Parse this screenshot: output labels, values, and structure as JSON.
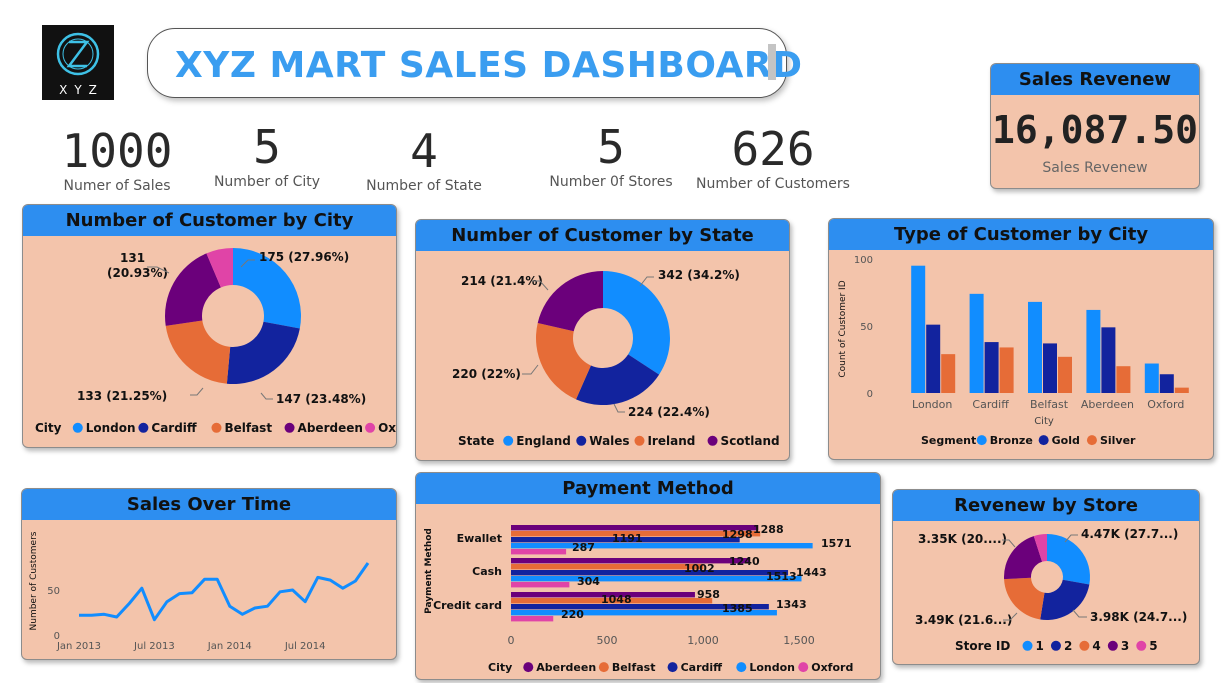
{
  "logo": {
    "text": "XYZ"
  },
  "title": "XYZ MART SALES DASHBOARD",
  "kpis": [
    {
      "value": "1000",
      "label": "Numer of Sales"
    },
    {
      "value": "5",
      "label": "Number of City"
    },
    {
      "value": "4",
      "label": "Number of State"
    },
    {
      "value": "5",
      "label": "Number 0f Stores"
    },
    {
      "value": "626",
      "label": "Number of Customers"
    }
  ],
  "revenue_card": {
    "title": "Sales Revenew",
    "value": "16,087.50",
    "label": "Sales Revenew"
  },
  "colors": {
    "bronze_blue": "#118dff",
    "navy": "#12239e",
    "orange": "#e66c37",
    "purple": "#6b007b",
    "pink": "#e044a7",
    "header": "#2d8ef0",
    "card_bg": "#f3c4ab"
  },
  "chart_data": [
    {
      "type": "pie",
      "title": "Number of Customer by City",
      "legend_title": "City",
      "categories": [
        "London",
        "Cardiff",
        "Belfast",
        "Aberdeen",
        "Oxford"
      ],
      "values": [
        175,
        147,
        133,
        131,
        40
      ],
      "data_labels": [
        "175 (27.96%)",
        "147 (23.48%)",
        "133 (21.25%)",
        "131",
        "(20.93%)"
      ],
      "colors": [
        "#118dff",
        "#12239e",
        "#e66c37",
        "#6b007b",
        "#e044a7"
      ],
      "legend_position": "bottom"
    },
    {
      "type": "pie",
      "title": "Number of Customer by State",
      "legend_title": "State",
      "categories": [
        "England",
        "Wales",
        "Ireland",
        "Scotland"
      ],
      "values": [
        342,
        224,
        220,
        214
      ],
      "data_labels": [
        "342 (34.2%)",
        "224 (22.4%)",
        "220 (22%)",
        "214 (21.4%)"
      ],
      "colors": [
        "#118dff",
        "#12239e",
        "#e66c37",
        "#6b007b"
      ],
      "legend_position": "bottom"
    },
    {
      "type": "bar",
      "title": "Type of Customer by City",
      "xlabel": "City",
      "ylabel": "Count of Customer ID",
      "legend_title": "Segment",
      "categories": [
        "London",
        "Cardiff",
        "Belfast",
        "Aberdeen",
        "Oxford"
      ],
      "series": [
        {
          "name": "Bronze",
          "values": [
            95,
            74,
            68,
            62,
            22
          ],
          "color": "#118dff"
        },
        {
          "name": "Gold",
          "values": [
            51,
            38,
            37,
            49,
            14
          ],
          "color": "#12239e"
        },
        {
          "name": "Silver",
          "values": [
            29,
            34,
            27,
            20,
            4
          ],
          "color": "#e66c37"
        }
      ],
      "ylim": [
        0,
        100
      ],
      "yticks": [
        "0",
        "50",
        "100"
      ],
      "legend_position": "bottom"
    },
    {
      "type": "line",
      "title": "Sales Over Time",
      "ylabel": "Number of Customers",
      "x": [
        "2013-01",
        "2013-02",
        "2013-03",
        "2013-04",
        "2013-05",
        "2013-06",
        "2013-07",
        "2013-08",
        "2013-09",
        "2013-10",
        "2013-11",
        "2013-12",
        "2014-01",
        "2014-02",
        "2014-03",
        "2014-04",
        "2014-05",
        "2014-06",
        "2014-07",
        "2014-08",
        "2014-09",
        "2014-10",
        "2014-11",
        "2014-12"
      ],
      "values": [
        22,
        22,
        23,
        20,
        35,
        52,
        17,
        37,
        46,
        47,
        62,
        62,
        32,
        23,
        30,
        32,
        48,
        50,
        37,
        64,
        61,
        52,
        60,
        80
      ],
      "xticks": [
        "Jan 2013",
        "Jul 2013",
        "Jan 2014",
        "Jul 2014"
      ],
      "yticks": [
        "0",
        "50"
      ],
      "color": "#118dff"
    },
    {
      "type": "bar",
      "orientation": "horizontal",
      "title": "Payment Method",
      "ylabel": "Payment Method",
      "legend_title": "City",
      "categories": [
        "Ewallet",
        "Cash",
        "Credit card"
      ],
      "series": [
        {
          "name": "Aberdeen",
          "values": [
            1288,
            1240,
            958
          ],
          "color": "#6b007b"
        },
        {
          "name": "Belfast",
          "values": [
            1298,
            1002,
            1048
          ],
          "color": "#e66c37"
        },
        {
          "name": "Cardiff",
          "values": [
            1191,
            1443,
            1343
          ],
          "color": "#12239e"
        },
        {
          "name": "London",
          "values": [
            1571,
            1513,
            1385
          ],
          "color": "#118dff"
        },
        {
          "name": "Oxford",
          "values": [
            287,
            304,
            220
          ],
          "color": "#e044a7"
        }
      ],
      "xlim": [
        0,
        1750
      ],
      "xticks": [
        "0",
        "500",
        "1,000",
        "1,500"
      ],
      "legend_position": "bottom"
    },
    {
      "type": "pie",
      "title": "Revenew by Store",
      "legend_title": "Store ID",
      "categories": [
        "1",
        "2",
        "4",
        "3",
        "5"
      ],
      "values": [
        4.47,
        3.98,
        3.49,
        3.35,
        0.8
      ],
      "data_labels": [
        "4.47K (27.7...)",
        "3.98K (24.7...)",
        "3.49K (21.6...)",
        "3.35K (20....)"
      ],
      "colors": [
        "#118dff",
        "#12239e",
        "#e66c37",
        "#6b007b",
        "#e044a7"
      ],
      "legend_position": "bottom"
    }
  ]
}
